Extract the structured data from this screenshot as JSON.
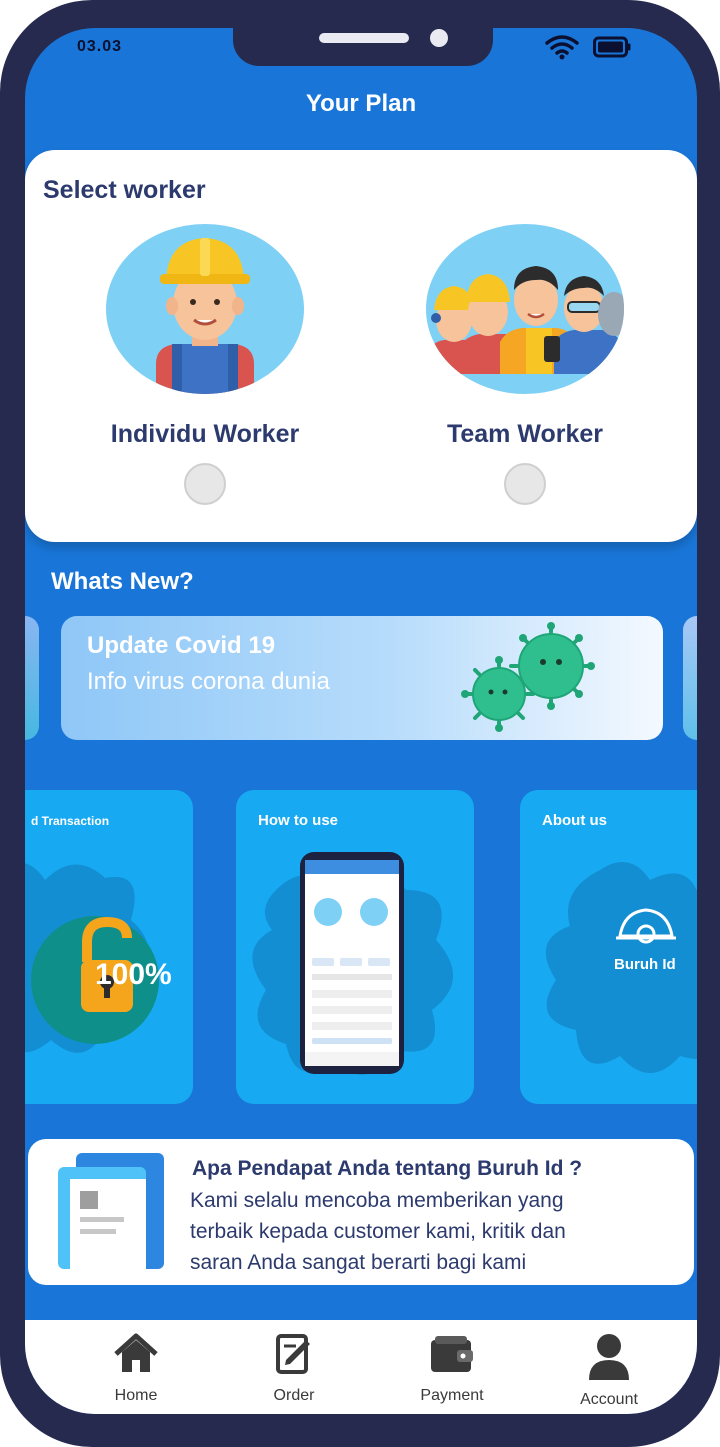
{
  "status_bar": {
    "time": "03.03",
    "icons": [
      "wifi-icon",
      "battery-icon"
    ]
  },
  "header": {
    "title": "Your Plan"
  },
  "select_worker": {
    "title": "Select worker",
    "options": [
      {
        "label": "Individu Worker",
        "icon": "individual-worker-avatar"
      },
      {
        "label": "Team Worker",
        "icon": "team-worker-avatar"
      }
    ]
  },
  "whats_new": {
    "title": "Whats New?",
    "banner": {
      "title": "Update Covid 19",
      "subtitle": "Info virus corona dunia",
      "icon": "virus-icon"
    }
  },
  "info_cards": [
    {
      "title": "d Transaction",
      "badge": "100%",
      "icon": "padlock-icon"
    },
    {
      "title": "How to use",
      "icon": "phone-preview"
    },
    {
      "title": "About us",
      "logo_text": "Buruh Id",
      "icon": "hardhat-logo"
    }
  ],
  "feedback": {
    "title": "Apa Pendapat Anda tentang Buruh Id ?",
    "lines": [
      "Kami selalu mencoba memberikan yang",
      "terbaik kepada customer kami, kritik dan",
      "saran Anda sangat berarti bagi kami"
    ],
    "icon": "document-icon"
  },
  "bottom_nav": {
    "items": [
      {
        "label": "Home",
        "icon": "home-icon"
      },
      {
        "label": "Order",
        "icon": "edit-icon"
      },
      {
        "label": "Payment",
        "icon": "wallet-icon"
      },
      {
        "label": "Account",
        "icon": "user-icon"
      }
    ]
  },
  "colors": {
    "background": "#1976d8",
    "card": "#ffffff",
    "info_card": "#17a9f2",
    "text_dark": "#2c3a6e",
    "frame": "#262a4f"
  }
}
